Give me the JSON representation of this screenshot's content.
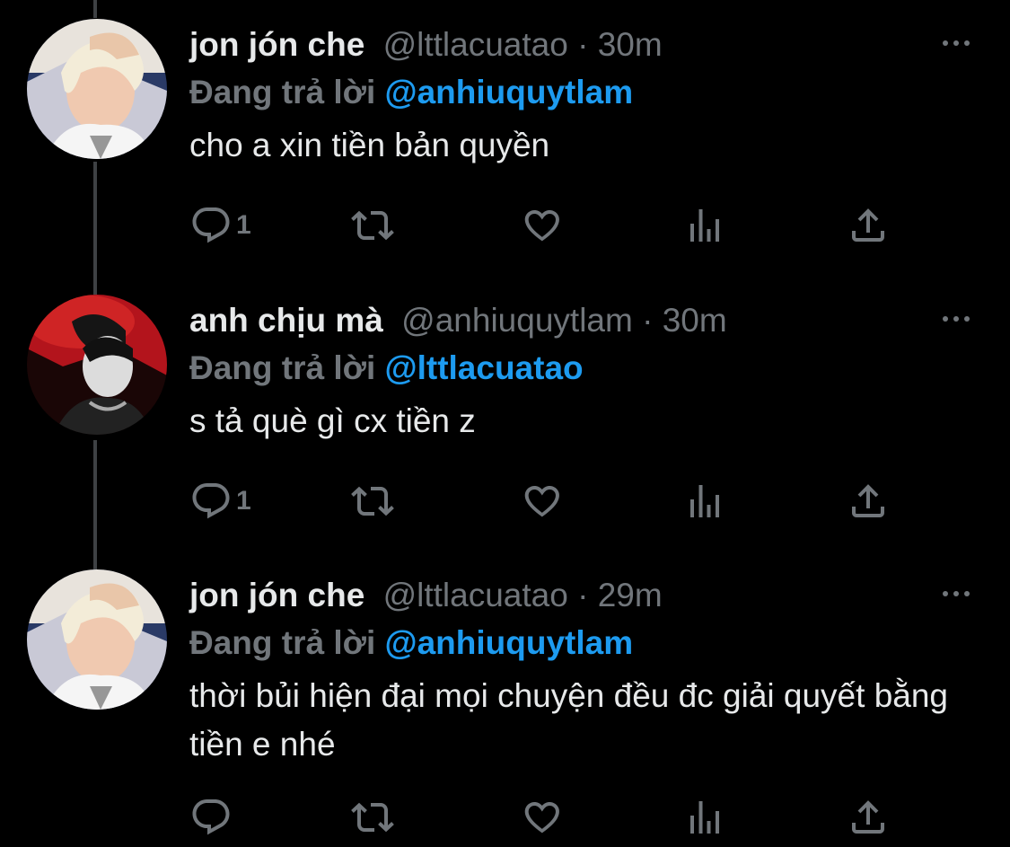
{
  "colors": {
    "background": "#000000",
    "primary_text": "#e7e9ea",
    "secondary_text": "#71767b",
    "mention": "#1d9bf0",
    "thread_line": "#3e4144"
  },
  "tweets": [
    {
      "name": "jon jón che",
      "handle": "@lttlacuatao",
      "separator": "·",
      "time": "30m",
      "replying_label": "Đang trả lời",
      "replying_to": "@anhiuquytlam",
      "text": "cho a xin tiền bản quyền",
      "reply_count": "1",
      "avatar": "blonde-avatar"
    },
    {
      "name": "anh chịu mà",
      "handle": "@anhiuquytlam",
      "separator": "·",
      "time": "30m",
      "replying_label": "Đang trả lời",
      "replying_to": "@lttlacuatao",
      "text": "s tả què gì cx tiền z",
      "reply_count": "1",
      "avatar": "red-stage-avatar"
    },
    {
      "name": "jon jón che",
      "handle": "@lttlacuatao",
      "separator": "·",
      "time": "29m",
      "replying_label": "Đang trả lời",
      "replying_to": "@anhiuquytlam",
      "text": "thời bủi hiện đại mọi chuyện đều đc giải quyết bằng tiền e nhé",
      "reply_count": "",
      "avatar": "blonde-avatar"
    }
  ],
  "icons": {
    "reply": "reply-icon",
    "retweet": "retweet-icon",
    "like": "heart-icon",
    "views": "views-icon",
    "share": "share-icon",
    "more": "more-icon"
  }
}
